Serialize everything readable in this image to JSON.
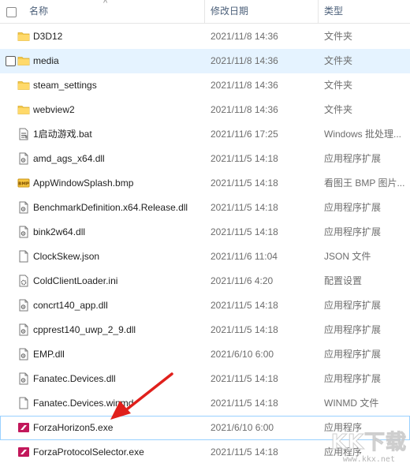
{
  "header": {
    "col_name": "名称",
    "col_date": "修改日期",
    "col_type": "类型"
  },
  "colors": {
    "folder": "#f3c94c",
    "arrow": "#e0201c",
    "hover": "#e5f3ff"
  },
  "files": [
    {
      "name": "D3D12",
      "date": "2021/11/8 14:36",
      "type": "文件夹",
      "icon": "folder-icon"
    },
    {
      "name": "media",
      "date": "2021/11/8 14:36",
      "type": "文件夹",
      "icon": "folder-icon"
    },
    {
      "name": "steam_settings",
      "date": "2021/11/8 14:36",
      "type": "文件夹",
      "icon": "folder-icon"
    },
    {
      "name": "webview2",
      "date": "2021/11/8 14:36",
      "type": "文件夹",
      "icon": "folder-icon"
    },
    {
      "name": "1启动游戏.bat",
      "date": "2021/11/6 17:25",
      "type": "Windows 批处理...",
      "icon": "bat-icon"
    },
    {
      "name": "amd_ags_x64.dll",
      "date": "2021/11/5 14:18",
      "type": "应用程序扩展",
      "icon": "dll-icon"
    },
    {
      "name": "AppWindowSplash.bmp",
      "date": "2021/11/5 14:18",
      "type": "看图王 BMP 图片...",
      "icon": "bmp-icon"
    },
    {
      "name": "BenchmarkDefinition.x64.Release.dll",
      "date": "2021/11/5 14:18",
      "type": "应用程序扩展",
      "icon": "dll-icon"
    },
    {
      "name": "bink2w64.dll",
      "date": "2021/11/5 14:18",
      "type": "应用程序扩展",
      "icon": "dll-icon"
    },
    {
      "name": "ClockSkew.json",
      "date": "2021/11/6 11:04",
      "type": "JSON 文件",
      "icon": "file-icon"
    },
    {
      "name": "ColdClientLoader.ini",
      "date": "2021/11/6 4:20",
      "type": "配置设置",
      "icon": "ini-icon"
    },
    {
      "name": "concrt140_app.dll",
      "date": "2021/11/5 14:18",
      "type": "应用程序扩展",
      "icon": "dll-icon"
    },
    {
      "name": "cpprest140_uwp_2_9.dll",
      "date": "2021/11/5 14:18",
      "type": "应用程序扩展",
      "icon": "dll-icon"
    },
    {
      "name": "EMP.dll",
      "date": "2021/6/10 6:00",
      "type": "应用程序扩展",
      "icon": "dll-icon"
    },
    {
      "name": "Fanatec.Devices.dll",
      "date": "2021/11/5 14:18",
      "type": "应用程序扩展",
      "icon": "dll-icon"
    },
    {
      "name": "Fanatec.Devices.winmd",
      "date": "2021/11/5 14:18",
      "type": "WINMD 文件",
      "icon": "file-icon"
    },
    {
      "name": "ForzaHorizon5.exe",
      "date": "2021/6/10 6:00",
      "type": "应用程序",
      "icon": "exe-icon"
    },
    {
      "name": "ForzaProtocolSelector.exe",
      "date": "2021/11/5 14:18",
      "type": "应用程序",
      "icon": "exe-icon"
    }
  ],
  "watermark": {
    "logo": "KK下载",
    "url": "www.kkx.net"
  }
}
